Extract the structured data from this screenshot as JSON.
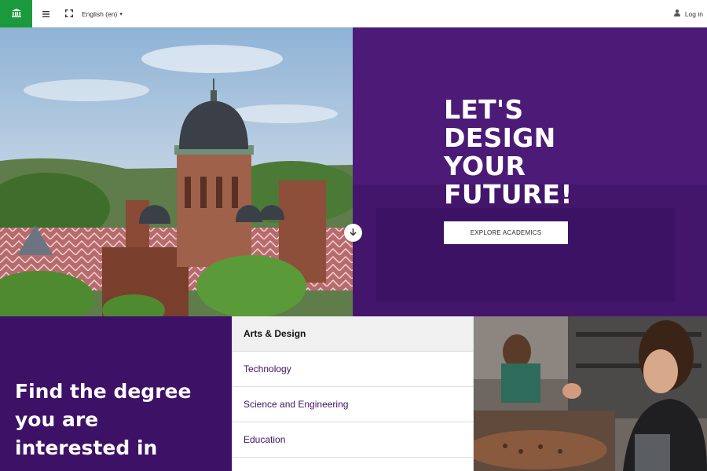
{
  "navbar": {
    "home_icon": "institution-icon",
    "menu_icon": "hamburger-icon",
    "fullscreen_icon": "fullscreen-icon",
    "language": "English (en)",
    "language_caret": "▾",
    "login_icon": "user-icon",
    "login_label": "Log in",
    "accent_color": "#1a9a3c"
  },
  "hero": {
    "heading_lines": [
      "LET'S",
      "DESIGN",
      "YOUR",
      "FUTURE!"
    ],
    "cta_label": "EXPLORE ACADEMICS",
    "scroll_icon": "arrow-down-icon",
    "panel_color": "#4b1b77"
  },
  "degrees": {
    "heading_lines": [
      "Find the degree",
      "you are",
      "interested in"
    ],
    "items": [
      {
        "label": "Arts & Design",
        "active": true
      },
      {
        "label": "Technology",
        "active": false
      },
      {
        "label": "Science and Engineering",
        "active": false
      },
      {
        "label": "Education",
        "active": false
      }
    ],
    "panel_color": "#3d1166"
  }
}
